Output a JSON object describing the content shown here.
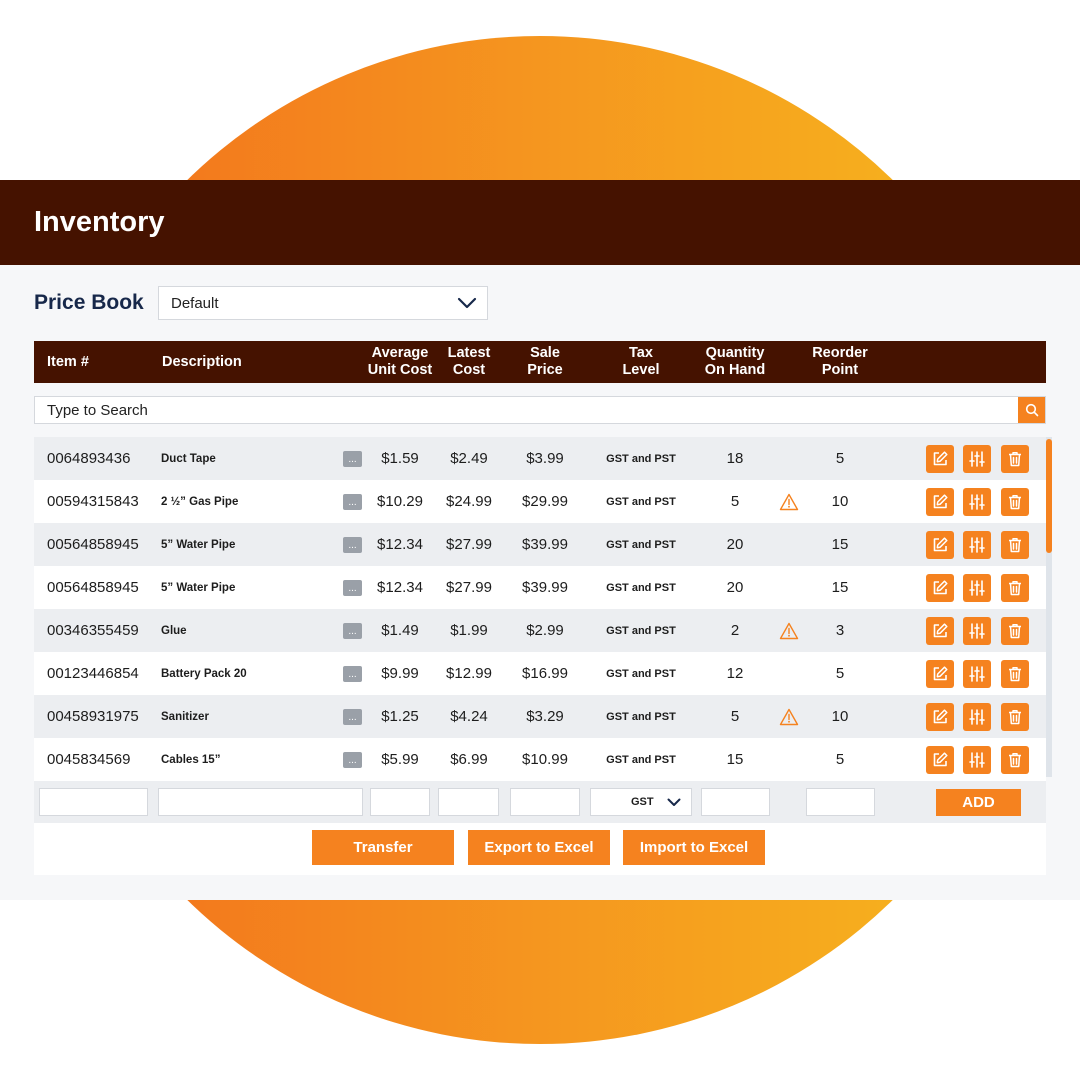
{
  "app": {
    "title": "Inventory"
  },
  "price_book": {
    "label": "Price Book",
    "selected": "Default"
  },
  "columns": {
    "item": "Item #",
    "description": "Description",
    "avg_cost_1": "Average",
    "avg_cost_2": "Unit Cost",
    "latest_cost_1": "Latest",
    "latest_cost_2": "Cost",
    "sale_price_1": "Sale",
    "sale_price_2": "Price",
    "tax_level_1": "Tax",
    "tax_level_2": "Level",
    "qty_1": "Quantity",
    "qty_2": "On Hand",
    "reorder_1": "Reorder",
    "reorder_2": "Point"
  },
  "search": {
    "placeholder": "Type to Search"
  },
  "rows": [
    {
      "item": "0064893436",
      "description": "Duct Tape",
      "more": "...",
      "avg_cost": "$1.59",
      "latest_cost": "$2.49",
      "sale_price": "$3.99",
      "tax_level": "GST and PST",
      "qty": "18",
      "warning": false,
      "reorder": "5"
    },
    {
      "item": "00594315843",
      "description": "2 ½” Gas Pipe",
      "more": "...",
      "avg_cost": "$10.29",
      "latest_cost": "$24.99",
      "sale_price": "$29.99",
      "tax_level": "GST and PST",
      "qty": "5",
      "warning": true,
      "reorder": "10"
    },
    {
      "item": "00564858945",
      "description": "5” Water Pipe",
      "more": "...",
      "avg_cost": "$12.34",
      "latest_cost": "$27.99",
      "sale_price": "$39.99",
      "tax_level": "GST and PST",
      "qty": "20",
      "warning": false,
      "reorder": "15"
    },
    {
      "item": "00564858945",
      "description": "5” Water Pipe",
      "more": "...",
      "avg_cost": "$12.34",
      "latest_cost": "$27.99",
      "sale_price": "$39.99",
      "tax_level": "GST and PST",
      "qty": "20",
      "warning": false,
      "reorder": "15"
    },
    {
      "item": "00346355459",
      "description": "Glue",
      "more": "...",
      "avg_cost": "$1.49",
      "latest_cost": "$1.99",
      "sale_price": "$2.99",
      "tax_level": "GST and PST",
      "qty": "2",
      "warning": true,
      "reorder": "3"
    },
    {
      "item": "00123446854",
      "description": "Battery Pack 20",
      "more": "...",
      "avg_cost": "$9.99",
      "latest_cost": "$12.99",
      "sale_price": "$16.99",
      "tax_level": "GST and PST",
      "qty": "12",
      "warning": false,
      "reorder": "5"
    },
    {
      "item": "00458931975",
      "description": "Sanitizer",
      "more": "...",
      "avg_cost": "$1.25",
      "latest_cost": "$4.24",
      "sale_price": "$3.29",
      "tax_level": "GST and PST",
      "qty": "5",
      "warning": true,
      "reorder": "10"
    },
    {
      "item": "0045834569",
      "description": "Cables 15”",
      "more": "...",
      "avg_cost": "$5.99",
      "latest_cost": "$6.99",
      "sale_price": "$10.99",
      "tax_level": "GST and PST",
      "qty": "15",
      "warning": false,
      "reorder": "5"
    }
  ],
  "add_row": {
    "tax_selected": "GST",
    "add_label": "ADD"
  },
  "footer": {
    "transfer": "Transfer",
    "export": "Export to Excel",
    "import": "Import to Excel"
  },
  "icons": {
    "search": "search-icon",
    "dropdown": "chevron-down-icon",
    "warning": "warning-triangle-icon",
    "edit": "edit-icon",
    "adjust": "sliders-icon",
    "delete": "trash-icon"
  },
  "colors": {
    "header_bg": "#451200",
    "accent": "#f5821f",
    "title_text": "#17284a",
    "circle_start": "#f26e1c",
    "circle_end": "#f7b91d"
  }
}
